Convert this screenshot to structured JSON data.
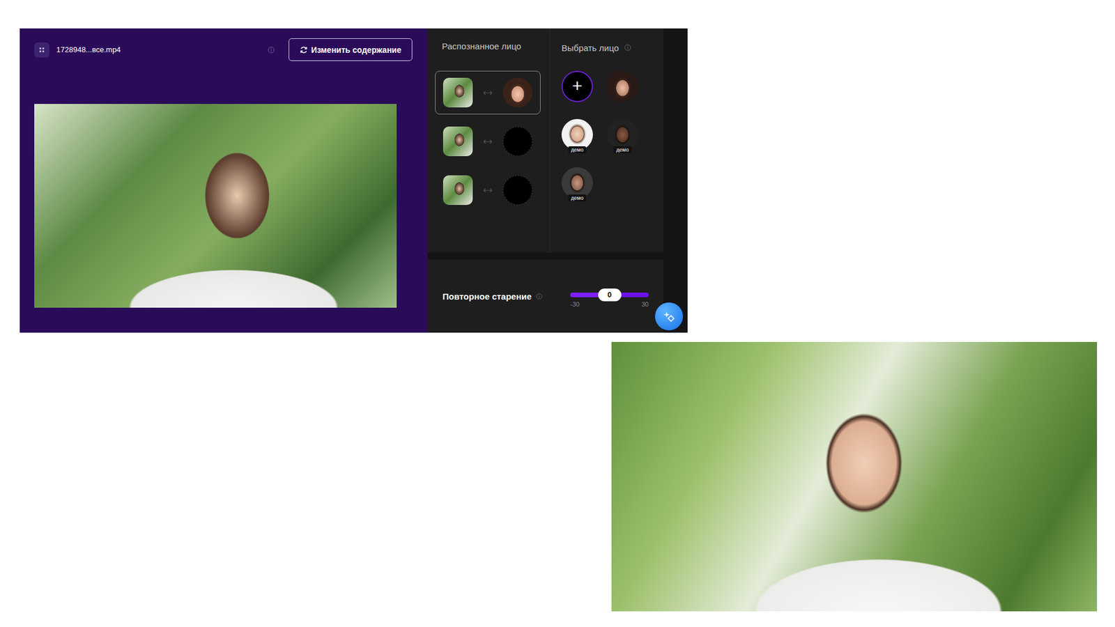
{
  "file": {
    "name": "1728948...все.mp4"
  },
  "change_button": {
    "label": "Изменить содержание"
  },
  "detected": {
    "title": "Распознанное лицо",
    "rows": [
      {
        "selected": true,
        "assigned": true
      },
      {
        "selected": false,
        "assigned": false
      },
      {
        "selected": false,
        "assigned": false
      }
    ]
  },
  "choose": {
    "title": "Выбрать лицо",
    "items": [
      {
        "kind": "add",
        "label": "+"
      },
      {
        "kind": "face",
        "badge": ""
      },
      {
        "kind": "face",
        "badge": "демо"
      },
      {
        "kind": "face",
        "badge": "демо"
      },
      {
        "kind": "face",
        "badge": "демо"
      }
    ]
  },
  "aging": {
    "label": "Повторное старение",
    "value": "0",
    "min": "-30",
    "max": "30",
    "level": 0.5
  }
}
